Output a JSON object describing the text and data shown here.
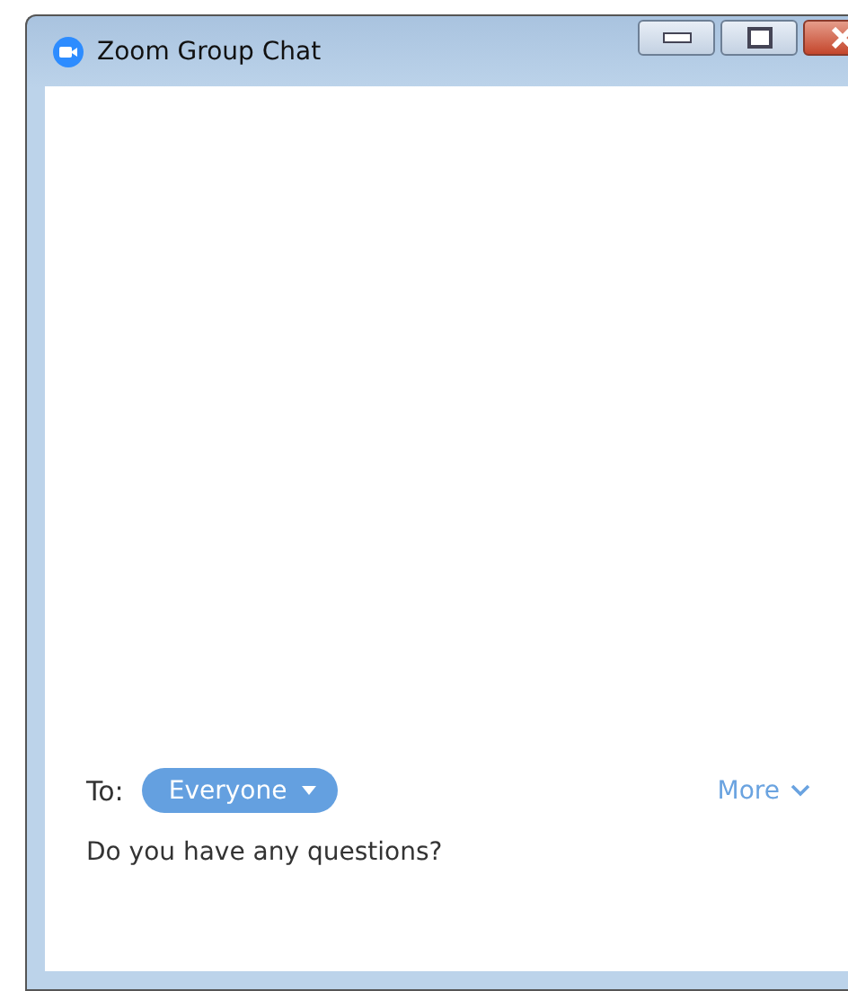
{
  "window": {
    "title": "Zoom Group Chat"
  },
  "chat": {
    "to_label": "To:",
    "recipient": "Everyone",
    "more": "More",
    "message": "Do you have any questions?"
  }
}
